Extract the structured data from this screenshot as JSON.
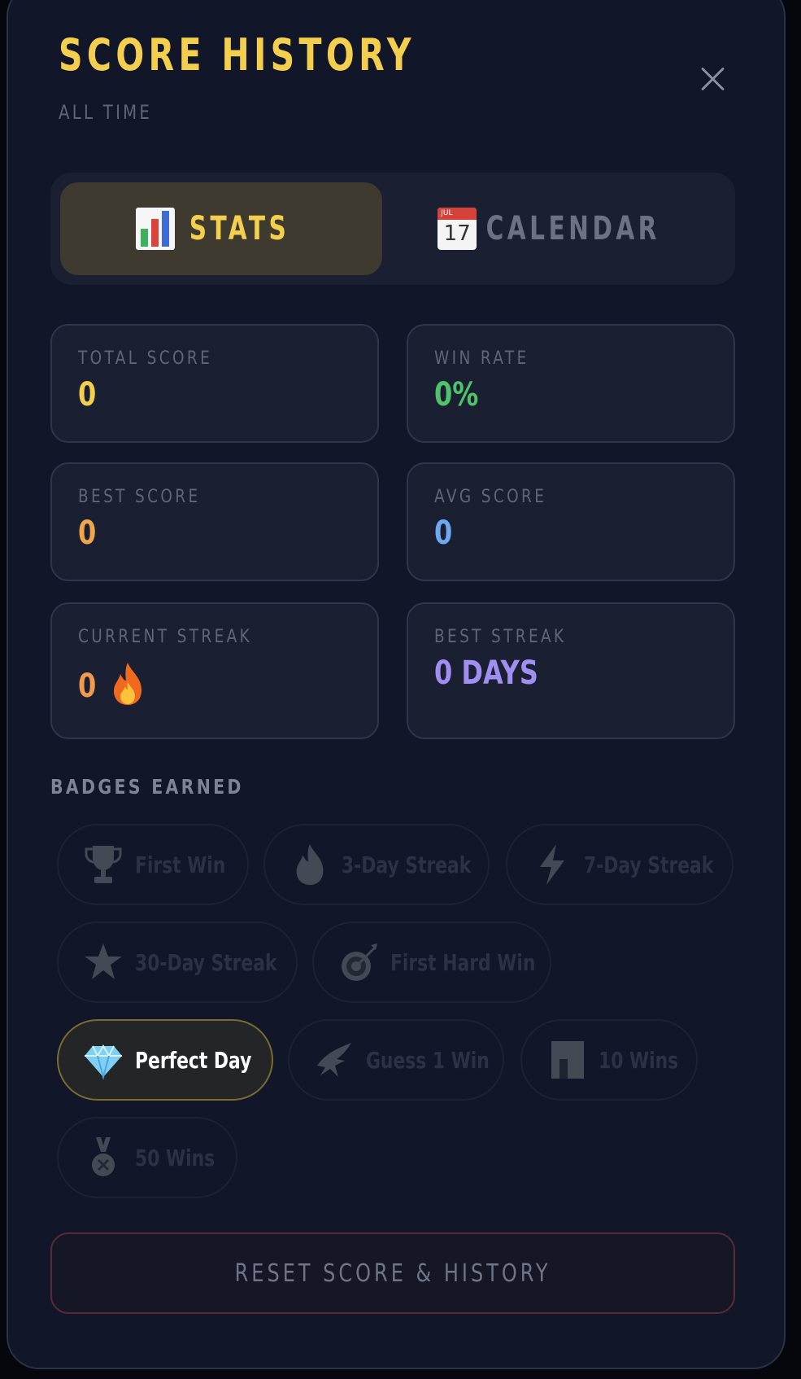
{
  "header": {
    "title": "SCORE HISTORY",
    "subtitle": "ALL TIME",
    "close_icon": "close-icon"
  },
  "tabs": [
    {
      "label": "STATS",
      "icon": "bar-chart-icon",
      "active": true
    },
    {
      "label": "CALENDAR",
      "icon": "calendar-icon",
      "calendar_month": "JUL",
      "calendar_day": "17",
      "active": false
    }
  ],
  "stats": {
    "total_score": {
      "label": "TOTAL SCORE",
      "value": "0",
      "color": "#f3cf4d"
    },
    "win_rate": {
      "label": "WIN RATE",
      "value": "0%",
      "color": "#4fc26a"
    },
    "best_score": {
      "label": "BEST SCORE",
      "value": "0",
      "color": "#eea64a"
    },
    "avg_score": {
      "label": "AVG SCORE",
      "value": "0",
      "color": "#6ea8f0"
    },
    "current_streak": {
      "label": "CURRENT STREAK",
      "value": "0",
      "icon": "fire-icon",
      "color": "#ef9a4f"
    },
    "best_streak": {
      "label": "BEST STREAK",
      "value": "0 DAYS",
      "color": "#a08ff0"
    }
  },
  "badges": {
    "section_label": "BADGES EARNED",
    "items": [
      {
        "label": "First Win",
        "icon": "trophy-icon",
        "earned": false
      },
      {
        "label": "3-Day Streak",
        "icon": "fire-icon",
        "earned": false
      },
      {
        "label": "7-Day Streak",
        "icon": "lightning-icon",
        "earned": false
      },
      {
        "label": "30-Day Streak",
        "icon": "star-icon",
        "earned": false
      },
      {
        "label": "First Hard Win",
        "icon": "target-icon",
        "earned": false
      },
      {
        "label": "Perfect Day",
        "icon": "diamond-icon",
        "earned": true
      },
      {
        "label": "Guess 1 Win",
        "icon": "eagle-icon",
        "earned": false
      },
      {
        "label": "10 Wins",
        "icon": "bar-icon",
        "earned": false
      },
      {
        "label": "50 Wins",
        "icon": "medal-icon",
        "earned": false
      }
    ]
  },
  "reset": {
    "label": "RESET SCORE & HISTORY"
  }
}
